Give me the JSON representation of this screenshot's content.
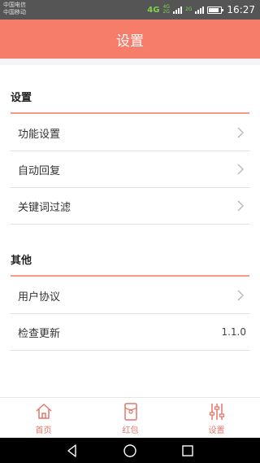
{
  "status_bar": {
    "carrier1": "中国电信",
    "carrier2": "中国移动",
    "network_4g": "4G",
    "network_4g_sub": "4G",
    "network_2g_sub": "2G",
    "network_2g": "2G",
    "battery_level": 0.8,
    "time": "16:27"
  },
  "header": {
    "title": "设置"
  },
  "sections": [
    {
      "title": "设置",
      "items": [
        {
          "label": "功能设置",
          "icon": "chevron-right-icon"
        },
        {
          "label": "自动回复",
          "icon": "chevron-right-icon"
        },
        {
          "label": "关键词过滤",
          "icon": "chevron-right-icon"
        }
      ]
    },
    {
      "title": "其他",
      "items": [
        {
          "label": "用户协议",
          "icon": "chevron-right-icon"
        },
        {
          "label": "检查更新",
          "value": "1.1.0"
        }
      ]
    }
  ],
  "tab_bar": {
    "tabs": [
      {
        "label": "首页",
        "icon": "home-icon"
      },
      {
        "label": "红包",
        "icon": "red-packet-icon"
      },
      {
        "label": "设置",
        "icon": "sliders-icon"
      }
    ]
  },
  "colors": {
    "accent": "#f77d6b",
    "section_line": "#f59a8b",
    "tab_label": "#e4776a"
  }
}
